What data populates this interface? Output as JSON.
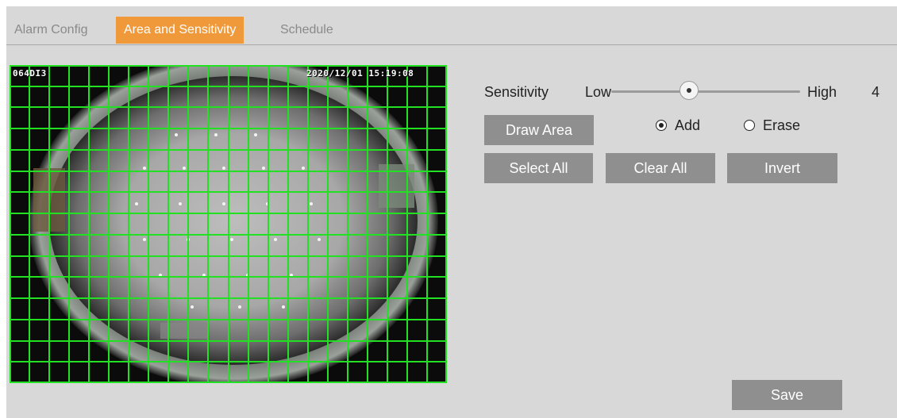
{
  "tabs": [
    {
      "label": "Alarm Config",
      "active": false
    },
    {
      "label": "Area and Sensitivity",
      "active": true
    },
    {
      "label": "Schedule",
      "active": false
    }
  ],
  "video": {
    "osd_left": "064DI3",
    "osd_right": "2020/12/01 15:19:08",
    "grid_color": "#22e022",
    "grid_rows": 15,
    "grid_cols": 22
  },
  "sensitivity": {
    "label": "Sensitivity",
    "low_label": "Low",
    "high_label": "High",
    "value": "4"
  },
  "draw": {
    "draw_area_label": "Draw Area",
    "add_label": "Add",
    "erase_label": "Erase",
    "selected_mode": "Add"
  },
  "actions": {
    "select_all_label": "Select All",
    "clear_all_label": "Clear All",
    "invert_label": "Invert",
    "save_label": "Save"
  },
  "colors": {
    "active_tab": "#f0993a",
    "button": "#8f8f8f",
    "panel": "#d8d8d8"
  }
}
